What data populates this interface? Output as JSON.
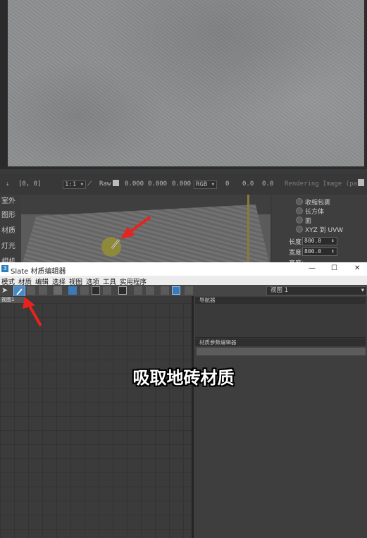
{
  "info_bar": {
    "coord": "[0, 0]",
    "zoom": "1:1",
    "raw_label": "Raw",
    "v1": "0.000",
    "v2": "0.000",
    "v3": "0.000",
    "color_mode": "RGB",
    "v4": "0",
    "v5": "0.0",
    "v6": "0.0",
    "render_label": "Rendering Image (pass"
  },
  "left_labels": [
    "室外",
    "图形",
    "材质",
    "灯光",
    "相机"
  ],
  "rollout": {
    "radios": [
      "收缩包裹",
      "长方体",
      "面",
      "XYZ 到 UVW"
    ],
    "length_label": "长度:",
    "length_value": "800.0",
    "width_label": "宽度:",
    "width_value": "800.0",
    "height_label": "高度:"
  },
  "window": {
    "title": "Slate 材质编辑器",
    "minimize": "—",
    "maximize": "☐",
    "close": "✕"
  },
  "menu": [
    "模式",
    "材质",
    "编辑",
    "选择",
    "视图",
    "选项",
    "工具",
    "实用程序"
  ],
  "view_dropdown": "视图 1",
  "tab_label": "视图1",
  "navigator_label": "导航器",
  "param_editor_label": "材质参数编辑器",
  "caption": "吸取地砖材质",
  "colors": {
    "arrow": "#e8221e",
    "eyedropper_active": "#4a88c8"
  },
  "icons": [
    "select-arrow-icon",
    "eyedropper-icon",
    "delete-icon",
    "layout-icon",
    "dropdown-chevron-icon"
  ]
}
